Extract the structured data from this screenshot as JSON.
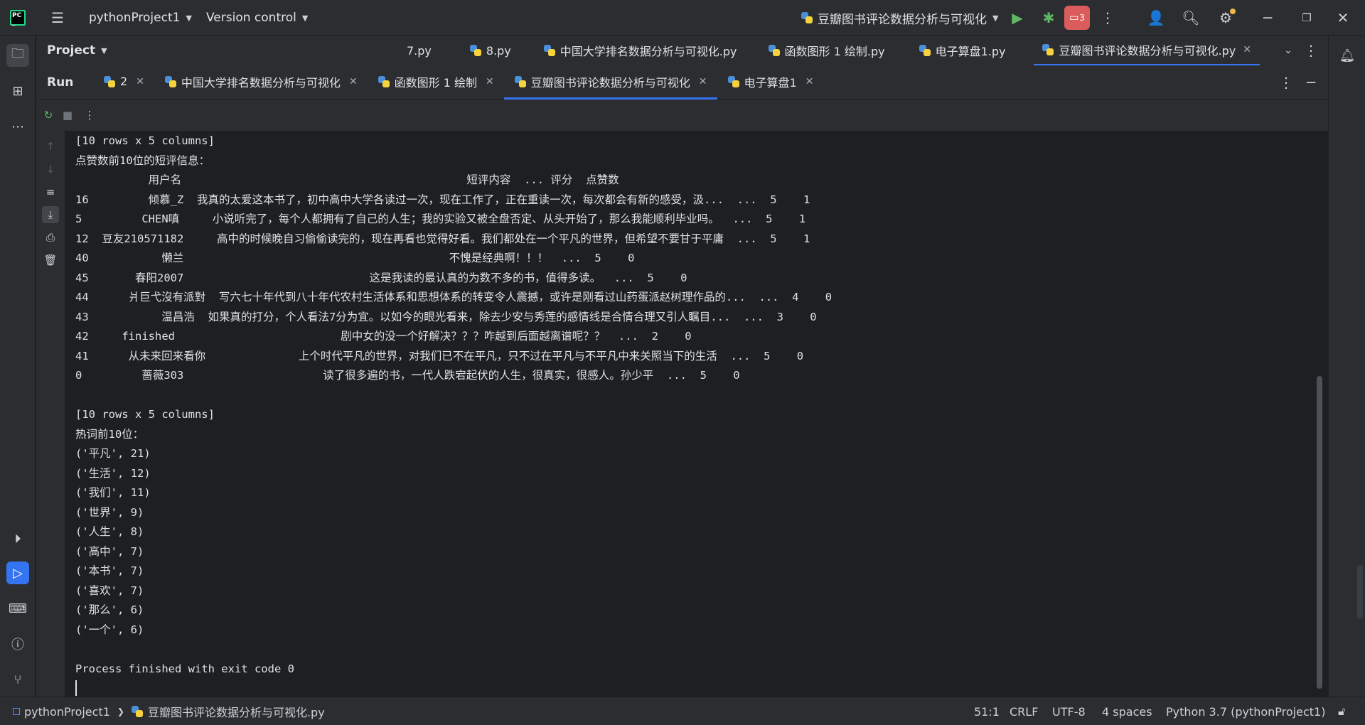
{
  "titlebar": {
    "project": "pythonProject1",
    "vcs": "Version control",
    "run_config": "豆瓣图书评论数据分析与可视化",
    "notification_count": "3"
  },
  "project_panel": {
    "label": "Project"
  },
  "editor_tabs": [
    {
      "label": "7.py"
    },
    {
      "label": "8.py"
    },
    {
      "label": "中国大学排名数据分析与可视化.py"
    },
    {
      "label": "函数图形 1 绘制.py"
    },
    {
      "label": "电子算盘1.py"
    },
    {
      "label": "豆瓣图书评论数据分析与可视化.py"
    }
  ],
  "run_panel": {
    "label": "Run",
    "tabs": [
      {
        "label": "2"
      },
      {
        "label": "中国大学排名数据分析与可视化"
      },
      {
        "label": "函数图形 1 绘制"
      },
      {
        "label": "豆瓣图书评论数据分析与可视化"
      },
      {
        "label": "电子算盘1"
      }
    ]
  },
  "console_lines": [
    "[10 rows x 5 columns]",
    "点赞数前10位的短评信息：",
    "           用户名                                           短评内容  ... 评分  点赞数",
    "16         倾慕_Z  我真的太爱这本书了，初中高中大学各读过一次，现在工作了，正在重读一次，每次都会有新的感受，汲...  ...  5    1",
    "5         CHEN嗔     小说听完了，每个人都拥有了自己的人生；我的实验又被全盘否定、从头开始了，那么我能顺利毕业吗。  ...  5    1",
    "12  豆友210571182     高中的时候晚自习偷偷读完的，现在再看也觉得好看。我们都处在一个平凡的世界，但希望不要甘于平庸  ...  5    1",
    "40           懒兰                                        不愧是经典啊！！！  ...  5    0",
    "45       春阳2007                            这是我读的最认真的为数不多的书，值得多读。  ...  5    0",
    "44      爿巨弋沒有派對  写六七十年代到八十年代农村生活体系和思想体系的转变令人震撼，或许是刚看过山药蛋派赵树理作品的...  ...  4    0",
    "43           温昌浩  如果真的打分，个人看法7分为宜。以如今的眼光看来，除去少安与秀莲的感情线是合情合理又引人瞩目...  ...  3    0",
    "42     finished                         剧中女的没一个好解决？？？咋越到后面越离谱呢？？  ...  2    0",
    "41      从未来回来看你              上个时代平凡的世界，对我们已不在平凡，只不过在平凡与不平凡中来关照当下的生活  ...  5    0",
    "0         蔷薇303                     读了很多遍的书，一代人跌宕起伏的人生，很真实，很感人。孙少平  ...  5    0",
    "",
    "[10 rows x 5 columns]",
    "热词前10位：",
    "('平凡', 21)",
    "('生活', 12)",
    "('我们', 11)",
    "('世界', 9)",
    "('人生', 8)",
    "('高中', 7)",
    "('本书', 7)",
    "('喜欢', 7)",
    "('那么', 6)",
    "('一个', 6)",
    "",
    "Process finished with exit code 0"
  ],
  "statusbar": {
    "breadcrumb_project": "pythonProject1",
    "breadcrumb_file": "豆瓣图书评论数据分析与可视化.py",
    "position": "51:1",
    "line_sep": "CRLF",
    "encoding": "UTF-8",
    "indent": "4 spaces",
    "interpreter": "Python 3.7 (pythonProject1)"
  },
  "colors": {
    "accent": "#3574f0",
    "run_green": "#5fb865",
    "notif_red": "#db5c5c",
    "bg": "#1e1f22",
    "panel": "#2b2d30"
  }
}
